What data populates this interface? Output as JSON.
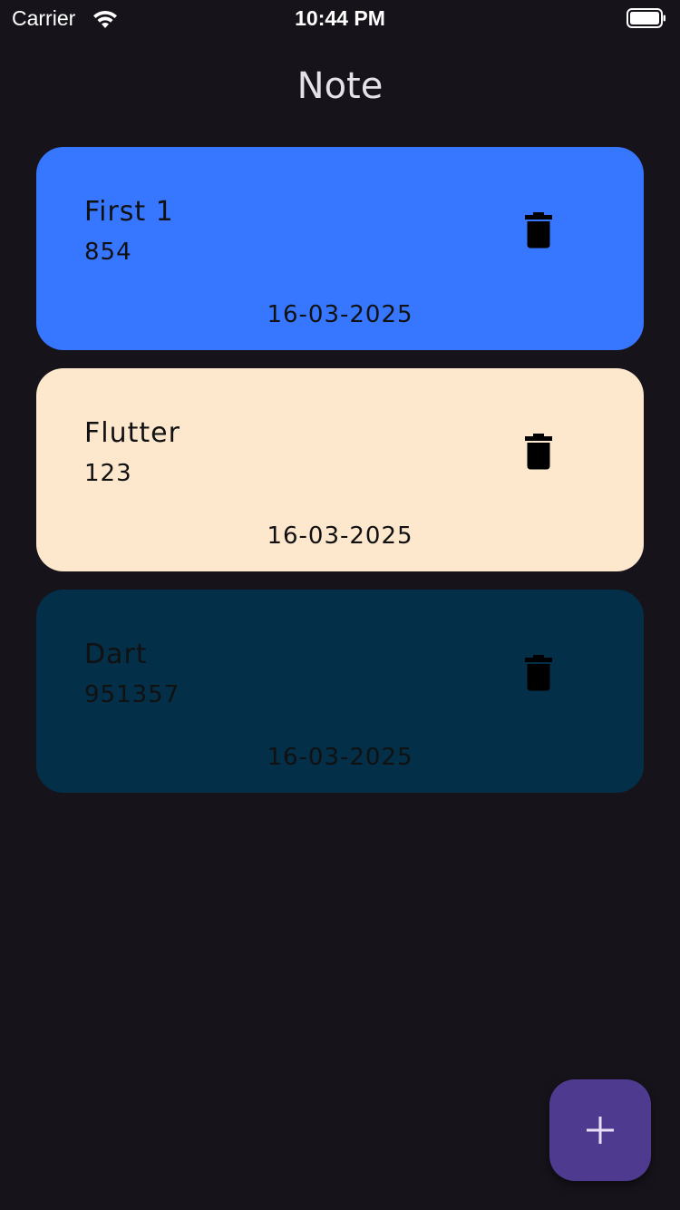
{
  "status_bar": {
    "carrier": "Carrier",
    "time": "10:44 PM",
    "icons": [
      "wifi-icon",
      "battery-icon"
    ]
  },
  "app_bar": {
    "title": "Note"
  },
  "notes": [
    {
      "title": "First 1",
      "content": "854",
      "date": "16-03-2025",
      "color": "#3777ff",
      "delete_icon": "trash-icon"
    },
    {
      "title": "Flutter",
      "content": "123",
      "date": "16-03-2025",
      "color": "#fde8cd",
      "delete_icon": "trash-icon"
    },
    {
      "title": "Dart",
      "content": "951357",
      "date": "16-03-2025",
      "color": "#032f48",
      "delete_icon": "trash-icon"
    }
  ],
  "fab": {
    "icon": "plus-icon",
    "color": "#4e3a8e"
  },
  "colors": {
    "background": "#16131a",
    "title_text": "#e6e1e9",
    "card_text": "#111111"
  }
}
